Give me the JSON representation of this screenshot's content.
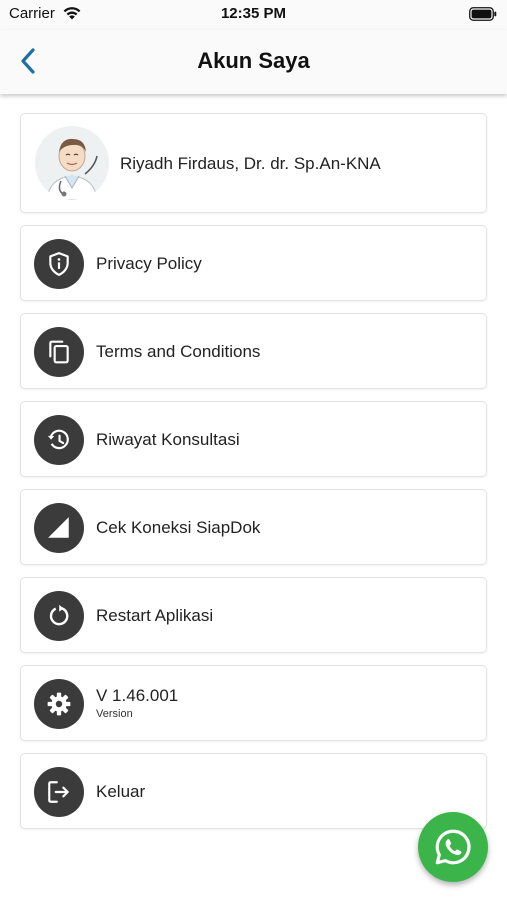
{
  "status_bar": {
    "carrier": "Carrier",
    "time": "12:35 PM"
  },
  "header": {
    "title": "Akun Saya",
    "back_icon": "chevron-left-icon"
  },
  "profile": {
    "name": "Riyadh Firdaus, Dr. dr. Sp.An-KNA"
  },
  "menu": [
    {
      "label": "Privacy Policy",
      "icon": "shield-info-icon"
    },
    {
      "label": "Terms and Conditions",
      "icon": "copy-icon"
    },
    {
      "label": "Riwayat Konsultasi",
      "icon": "history-icon"
    },
    {
      "label": "Cek Koneksi SiapDok",
      "icon": "signal-icon"
    },
    {
      "label": "Restart Aplikasi",
      "icon": "restart-icon"
    },
    {
      "label": "V 1.46.001",
      "sublabel": "Version",
      "icon": "gear-icon"
    },
    {
      "label": "Keluar",
      "icon": "logout-icon"
    }
  ],
  "fab": {
    "icon": "whatsapp-icon"
  },
  "colors": {
    "accent": "#1f6fa3",
    "icon_bg": "#3b3b3b",
    "whatsapp": "#3bb54a"
  }
}
